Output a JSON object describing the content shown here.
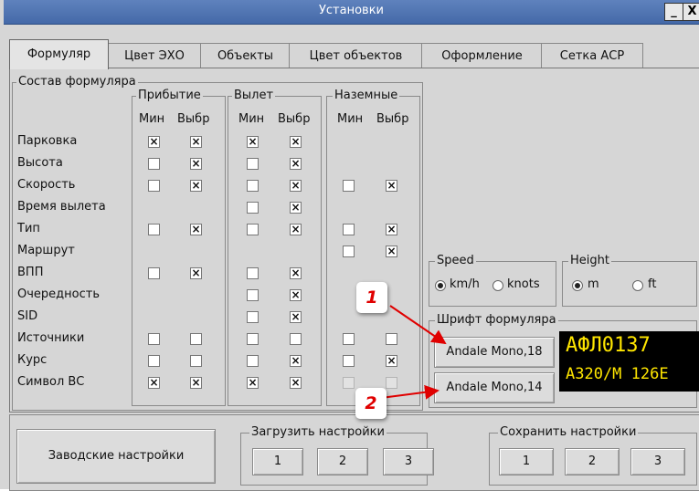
{
  "window": {
    "title": "Установки",
    "min_label": "_",
    "close_label": "X"
  },
  "tabs": [
    "Формуляр",
    "Цвет ЭХО",
    "Объекты",
    "Цвет объектов",
    "Оформление",
    "Сетка АСР"
  ],
  "composition": {
    "title": "Состав формуляра",
    "groups": [
      "Прибытие",
      "Вылет",
      "Наземные"
    ],
    "col_min": "Мин",
    "col_sel": "Выбр",
    "rows": [
      {
        "label": "Парковка",
        "arr_min": "x",
        "arr_sel": "x",
        "dep_min": "x",
        "dep_sel": "x",
        "gnd_min": "-",
        "gnd_sel": "-"
      },
      {
        "label": "Высота",
        "arr_min": "o",
        "arr_sel": "x",
        "dep_min": "o",
        "dep_sel": "x",
        "gnd_min": "-",
        "gnd_sel": "-"
      },
      {
        "label": "Скорость",
        "arr_min": "o",
        "arr_sel": "x",
        "dep_min": "o",
        "dep_sel": "x",
        "gnd_min": "o",
        "gnd_sel": "x"
      },
      {
        "label": "Время вылета",
        "arr_min": "-",
        "arr_sel": "-",
        "dep_min": "o",
        "dep_sel": "x",
        "gnd_min": "-",
        "gnd_sel": "-"
      },
      {
        "label": "Тип",
        "arr_min": "o",
        "arr_sel": "x",
        "dep_min": "o",
        "dep_sel": "x",
        "gnd_min": "o",
        "gnd_sel": "x"
      },
      {
        "label": "Маршрут",
        "arr_min": "-",
        "arr_sel": "-",
        "dep_min": "-",
        "dep_sel": "-",
        "gnd_min": "o",
        "gnd_sel": "x"
      },
      {
        "label": "ВПП",
        "arr_min": "o",
        "arr_sel": "x",
        "dep_min": "o",
        "dep_sel": "x",
        "gnd_min": "-",
        "gnd_sel": "-"
      },
      {
        "label": "Очередность",
        "arr_min": "-",
        "arr_sel": "-",
        "dep_min": "o",
        "dep_sel": "x",
        "gnd_min": "-",
        "gnd_sel": "-"
      },
      {
        "label": "SID",
        "arr_min": "-",
        "arr_sel": "-",
        "dep_min": "o",
        "dep_sel": "x",
        "gnd_min": "-",
        "gnd_sel": "-"
      },
      {
        "label": "Источники",
        "arr_min": "o",
        "arr_sel": "o",
        "dep_min": "o",
        "dep_sel": "o",
        "gnd_min": "o",
        "gnd_sel": "o"
      },
      {
        "label": "Курс",
        "arr_min": "o",
        "arr_sel": "o",
        "dep_min": "o",
        "dep_sel": "x",
        "gnd_min": "o",
        "gnd_sel": "x"
      },
      {
        "label": "Символ ВС",
        "arr_min": "x",
        "arr_sel": "x",
        "dep_min": "x",
        "dep_sel": "x",
        "gnd_min": "d",
        "gnd_sel": "d"
      }
    ]
  },
  "speed": {
    "title": "Speed",
    "options": [
      "km/h",
      "knots"
    ],
    "selected": "km/h"
  },
  "height": {
    "title": "Height",
    "options": [
      "m",
      "ft"
    ],
    "selected": "m"
  },
  "font": {
    "title": "Шрифт формуляра",
    "buttons": [
      "Andale Mono,18",
      "Andale Mono,14"
    ],
    "preview_line1": "АФЛ0137",
    "preview_line2": "А320/М 126Е"
  },
  "callouts": [
    "1",
    "2"
  ],
  "bottom": {
    "factory_label": "Заводские настройки",
    "load_title": "Загрузить настройки",
    "save_title": "Сохранить настройки",
    "slots": [
      "1",
      "2",
      "3"
    ]
  },
  "colors": {
    "title_bar": "#4f74b3",
    "preview_bg": "#000000",
    "preview_text": "#ffe600",
    "callout_text": "#e00000",
    "arrow": "#e00000"
  }
}
